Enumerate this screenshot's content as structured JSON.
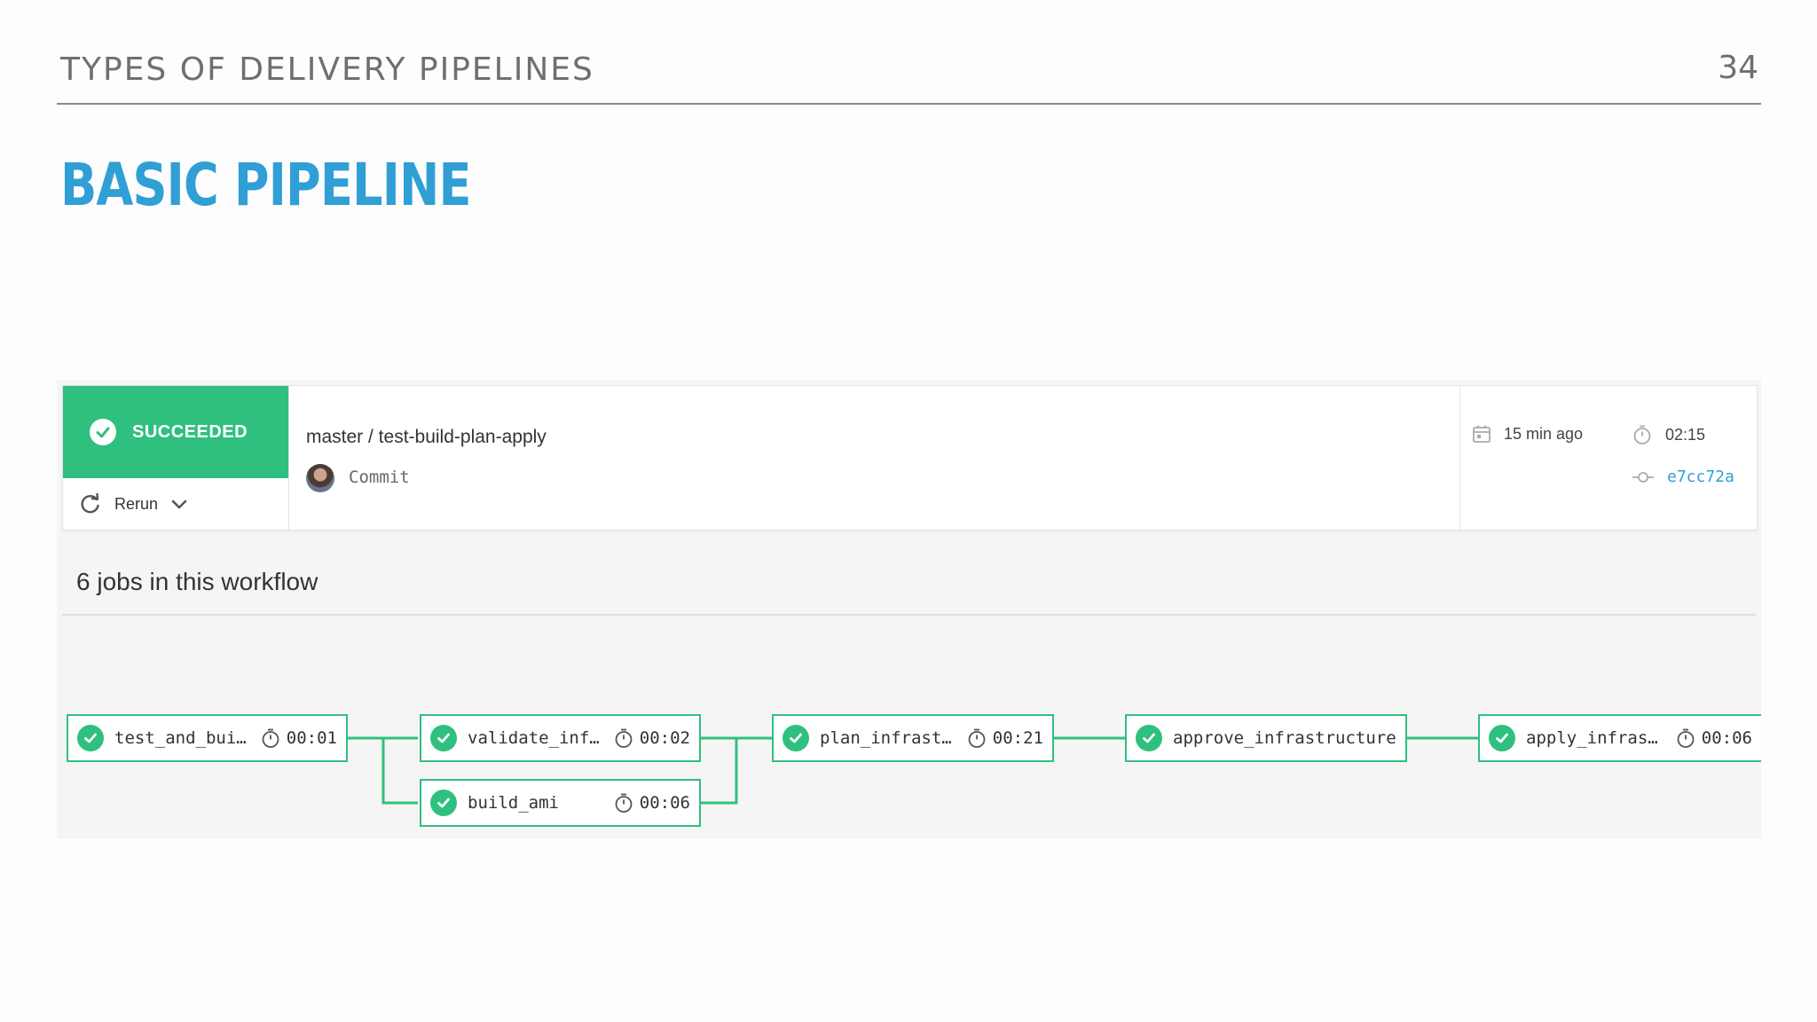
{
  "slide": {
    "header": "TYPES OF DELIVERY PIPELINES",
    "page_number": "34",
    "title": "BASIC PIPELINE"
  },
  "workflow": {
    "status": "SUCCEEDED",
    "rerun_label": "Rerun",
    "branch": "master / test-build-plan-apply",
    "commit_label": "Commit",
    "time_ago": "15 min ago",
    "duration": "02:15",
    "commit_hash": "e7cc72a",
    "jobs_title": "6 jobs in this workflow",
    "jobs": [
      {
        "name": "test_and_bui…",
        "time": "00:01"
      },
      {
        "name": "validate_inf…",
        "time": "00:02"
      },
      {
        "name": "build_ami",
        "time": "00:06"
      },
      {
        "name": "plan_infrast…",
        "time": "00:21"
      },
      {
        "name": "approve_infrastructure",
        "time": ""
      },
      {
        "name": "apply_infras…",
        "time": "00:06"
      }
    ]
  },
  "colors": {
    "success": "#2fc07f",
    "title_blue": "#2f9fd6",
    "header_gray": "#6f6f6f"
  },
  "icons": [
    "check-circle-icon",
    "rerun-icon",
    "chevron-down-icon",
    "calendar-icon",
    "stopwatch-icon",
    "commit-icon",
    "avatar"
  ]
}
